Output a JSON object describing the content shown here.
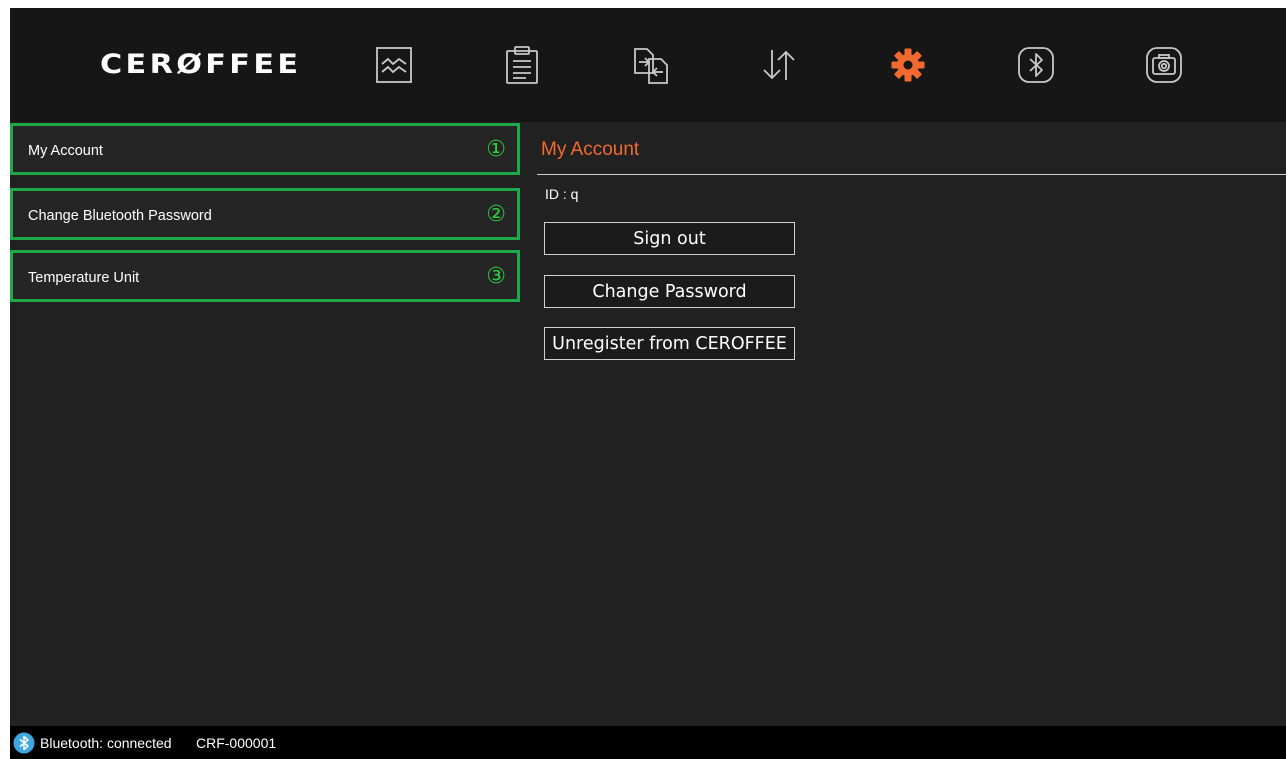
{
  "header": {
    "logo": "CERØFFEE",
    "nav": [
      {
        "icon": "chart-icon"
      },
      {
        "icon": "clipboard-icon"
      },
      {
        "icon": "file-transfer-icon"
      },
      {
        "icon": "sort-arrows-icon"
      },
      {
        "icon": "gear-icon",
        "active": true
      },
      {
        "icon": "bluetooth-icon"
      },
      {
        "icon": "camera-icon"
      }
    ],
    "colors": {
      "active": "#f26a30",
      "inactive": "#c8c8c8"
    }
  },
  "sidebar": {
    "items": [
      {
        "label": "My Account",
        "number": "①"
      },
      {
        "label": "Change Bluetooth Password",
        "number": "②"
      },
      {
        "label": "Temperature Unit",
        "number": "③"
      }
    ],
    "highlight_color": "#1fa84a"
  },
  "panel": {
    "title": "My Account",
    "id_text": "ID : q",
    "buttons": [
      {
        "label": "Sign out"
      },
      {
        "label": "Change Password"
      },
      {
        "label": "Unregister from CEROFFEE"
      }
    ]
  },
  "statusbar": {
    "icon": "bluetooth-icon",
    "text": "Bluetooth: connected",
    "device": "CRF-000001"
  }
}
